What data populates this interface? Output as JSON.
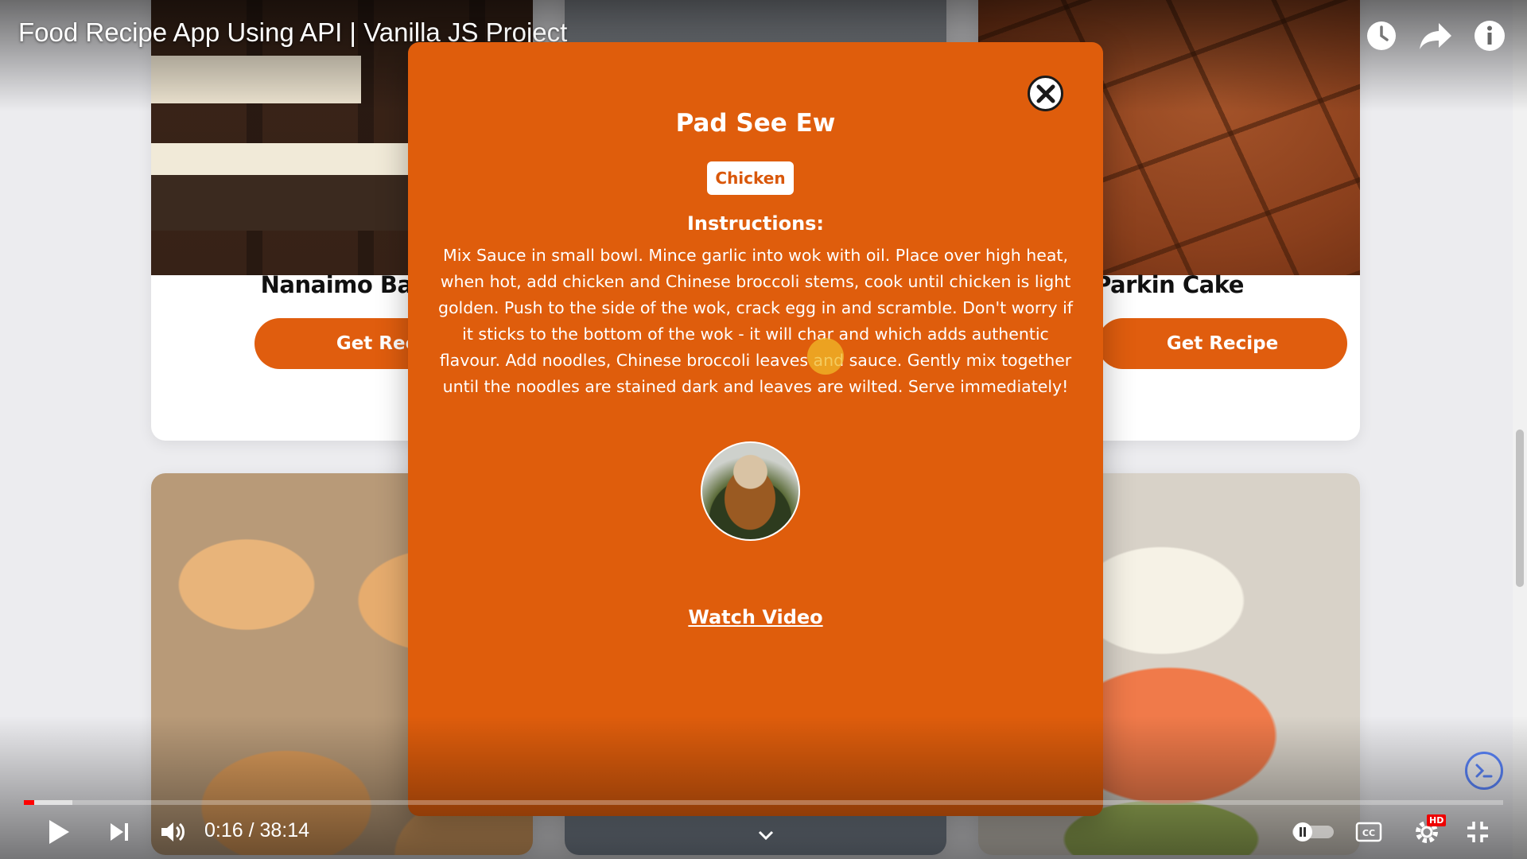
{
  "video": {
    "title": "Food Recipe App Using API | Vanilla JS Project",
    "time": "0:16 / 38:14",
    "progress_fraction": 0.007,
    "buffered_fraction": 0.033
  },
  "cards": [
    {
      "title": "Nanaimo Bar",
      "button": "Get Recipe"
    },
    {
      "title": "Parkin Cake",
      "button": "Get Recipe"
    }
  ],
  "modal": {
    "title": "Pad See Ew",
    "category": "Chicken",
    "instructions_heading": "Instructions:",
    "instructions": "Mix Sauce in small bowl. Mince garlic into wok with oil. Place over high heat, when hot, add chicken and Chinese broccoli stems, cook until chicken is light golden. Push to the side of the wok, crack egg in and scramble. Don't worry if it sticks to the bottom of the wok - it will char and which adds authentic flavour. Add noodles, Chinese broccoli leaves and sauce. Gently mix together until the noodles are stained dark and leaves are wilted. Serve immediately!",
    "video_link": "Watch Video"
  },
  "icons": {
    "watch_later": "clock-icon",
    "share": "share-arrow-icon",
    "info": "info-icon",
    "close": "close-icon",
    "play": "play-icon",
    "next": "next-icon",
    "volume": "volume-icon",
    "autoplay": "autoplay-toggle-icon",
    "captions": "cc-icon",
    "settings": "gear-icon",
    "exit_fullscreen": "exit-fullscreen-icon",
    "scroll_down": "chevron-down-icon"
  },
  "badges": {
    "settings": "HD"
  },
  "colors": {
    "accent": "#df5d0c",
    "progress": "#ff0000"
  }
}
